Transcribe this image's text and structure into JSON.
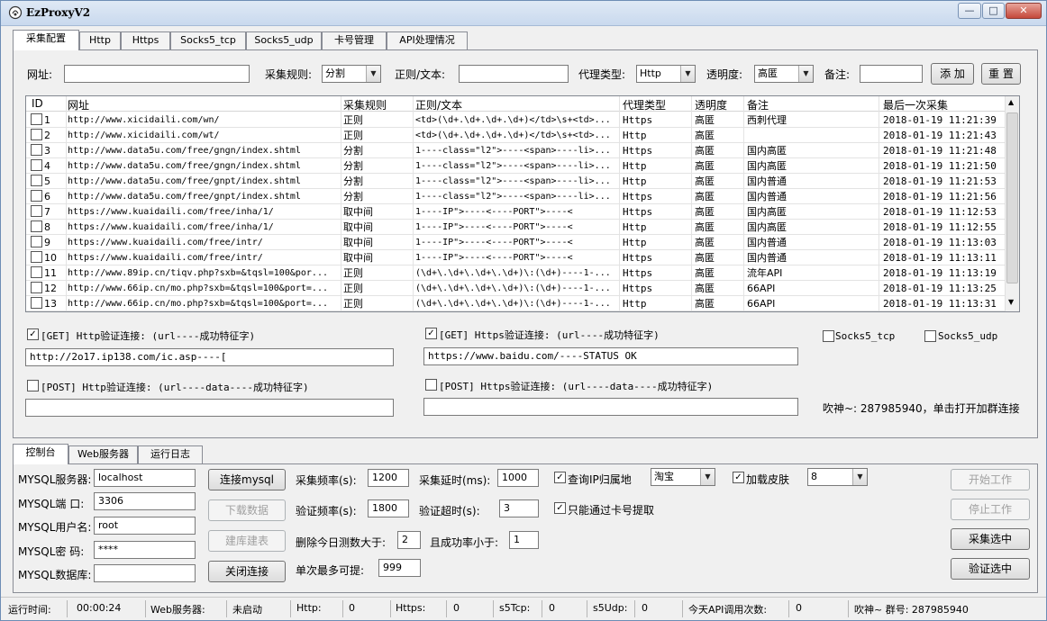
{
  "window": {
    "title": "EzProxyV2",
    "min": "—",
    "max": "□",
    "close": "✕"
  },
  "main_tabs": [
    "采集配置",
    "Http",
    "Https",
    "Socks5_tcp",
    "Socks5_udp",
    "卡号管理",
    "API处理情况"
  ],
  "form": {
    "url_label": "网址:",
    "url_value": "",
    "rule_label": "采集规则:",
    "rule_value": "分割",
    "regex_label": "正则/文本:",
    "regex_value": "",
    "proxy_type_label": "代理类型:",
    "proxy_type_value": "Http",
    "anon_label": "透明度:",
    "anon_value": "高匿",
    "remark_label": "备注:",
    "remark_value": "",
    "add_button": "添 加",
    "reset_button": "重 置"
  },
  "table": {
    "headers": [
      "ID",
      "网址",
      "采集规则",
      "正则/文本",
      "代理类型",
      "透明度",
      "备注",
      "最后一次采集"
    ],
    "rows": [
      [
        "1",
        "http://www.xicidaili.com/wn/",
        "正则",
        "<td>(\\d+.\\d+.\\d+.\\d+)</td>\\s+<td>...",
        "Https",
        "高匿",
        "西刺代理",
        "2018-01-19 11:21:39"
      ],
      [
        "2",
        "http://www.xicidaili.com/wt/",
        "正则",
        "<td>(\\d+.\\d+.\\d+.\\d+)</td>\\s+<td>...",
        "Http",
        "高匿",
        "",
        "2018-01-19 11:21:43"
      ],
      [
        "3",
        "http://www.data5u.com/free/gngn/index.shtml",
        "分割",
        "1----class=\"l2\">----<span>----li>...",
        "Https",
        "高匿",
        "国内高匿",
        "2018-01-19 11:21:48"
      ],
      [
        "4",
        "http://www.data5u.com/free/gngn/index.shtml",
        "分割",
        "1----class=\"l2\">----<span>----li>...",
        "Http",
        "高匿",
        "国内高匿",
        "2018-01-19 11:21:50"
      ],
      [
        "5",
        "http://www.data5u.com/free/gnpt/index.shtml",
        "分割",
        "1----class=\"l2\">----<span>----li>...",
        "Http",
        "高匿",
        "国内普通",
        "2018-01-19 11:21:53"
      ],
      [
        "6",
        "http://www.data5u.com/free/gnpt/index.shtml",
        "分割",
        "1----class=\"l2\">----<span>----li>...",
        "Https",
        "高匿",
        "国内普通",
        "2018-01-19 11:21:56"
      ],
      [
        "7",
        "https://www.kuaidaili.com/free/inha/1/",
        "取中间",
        "1----IP\">----<----PORT\">----<",
        "Https",
        "高匿",
        "国内高匿",
        "2018-01-19 11:12:53"
      ],
      [
        "8",
        "https://www.kuaidaili.com/free/inha/1/",
        "取中间",
        "1----IP\">----<----PORT\">----<",
        "Http",
        "高匿",
        "国内高匿",
        "2018-01-19 11:12:55"
      ],
      [
        "9",
        "https://www.kuaidaili.com/free/intr/",
        "取中间",
        "1----IP\">----<----PORT\">----<",
        "Http",
        "高匿",
        "国内普通",
        "2018-01-19 11:13:03"
      ],
      [
        "10",
        "https://www.kuaidaili.com/free/intr/",
        "取中间",
        "1----IP\">----<----PORT\">----<",
        "Https",
        "高匿",
        "国内普通",
        "2018-01-19 11:13:11"
      ],
      [
        "11",
        "http://www.89ip.cn/tiqv.php?sxb=&tqsl=100&por...",
        "正则",
        "(\\d+\\.\\d+\\.\\d+\\.\\d+)\\:(\\d+)----1-...",
        "Https",
        "高匿",
        "流年API",
        "2018-01-19 11:13:19"
      ],
      [
        "12",
        "http://www.66ip.cn/mo.php?sxb=&tqsl=100&port=...",
        "正则",
        "(\\d+\\.\\d+\\.\\d+\\.\\d+)\\:(\\d+)----1-...",
        "Https",
        "高匿",
        "66API",
        "2018-01-19 11:13:25"
      ],
      [
        "13",
        "http://www.66ip.cn/mo.php?sxb=&tqsl=100&port=...",
        "正则",
        "(\\d+\\.\\d+\\.\\d+\\.\\d+)\\:(\\d+)----1-...",
        "Http",
        "高匿",
        "66API",
        "2018-01-19 11:13:31"
      ]
    ]
  },
  "verify": {
    "http_get_label": "[GET] Http验证连接: (url----成功特征字)",
    "http_get_value": "http://2o17.ip138.com/ic.asp----[",
    "https_get_label": "[GET] Https验证连接: (url----成功特征字)",
    "https_get_value": "https://www.baidu.com/----STATUS OK",
    "http_post_label": "[POST] Http验证连接: (url----data----成功特征字)",
    "http_post_value": "",
    "https_post_label": "[POST] Https验证连接: (url----data----成功特征字)",
    "https_post_value": "",
    "socks5_tcp": "Socks5_tcp",
    "socks5_udp": "Socks5_udp",
    "group_note": "吹神~: 287985940，单击打开加群连接"
  },
  "bottom_tabs": [
    "控制台",
    "Web服务器",
    "运行日志"
  ],
  "mysql": {
    "server_label": "MYSQL服务器:",
    "server_value": "localhost",
    "port_label": "MYSQL端  口:",
    "port_value": "3306",
    "user_label": "MYSQL用户名:",
    "user_value": "root",
    "pass_label": "MYSQL密  码:",
    "pass_value": "****",
    "db_label": "MYSQL数据库:",
    "db_value": "",
    "connect_button": "连接mysql",
    "download_button": "下载数据",
    "create_button": "建库建表",
    "close_button": "关闭连接"
  },
  "settings": {
    "collect_freq_label": "采集频率(s):",
    "collect_freq_value": "1200",
    "collect_delay_label": "采集延时(ms):",
    "collect_delay_value": "1000",
    "verify_freq_label": "验证频率(s):",
    "verify_freq_value": "1800",
    "verify_timeout_label": "验证超时(s):",
    "verify_timeout_value": "3",
    "delete_label": "删除今日测数大于:",
    "delete_value": "2",
    "success_label": "且成功率小于:",
    "success_value": "1",
    "max_label": "单次最多可提:",
    "max_value": "999",
    "query_ip_label": "查询IP归属地",
    "query_ip_select": "淘宝",
    "skin_label": "加载皮肤",
    "skin_select": "8",
    "card_only_label": "只能通过卡号提取"
  },
  "actions": {
    "start": "开始工作",
    "stop": "停止工作",
    "collect_selected": "采集选中",
    "verify_selected": "验证选中"
  },
  "status": {
    "runtime_label": "运行时间:",
    "runtime_value": "00:00:24",
    "web_label": "Web服务器:",
    "web_value": "未启动",
    "http_label": "Http:",
    "http_value": "0",
    "https_label": "Https:",
    "https_value": "0",
    "s5tcp_label": "s5Tcp:",
    "s5tcp_value": "0",
    "s5udp_label": "s5Udp:",
    "s5udp_value": "0",
    "api_label": "今天API调用次数:",
    "api_value": "0",
    "group_text": "吹神~ 群号: 287985940"
  }
}
